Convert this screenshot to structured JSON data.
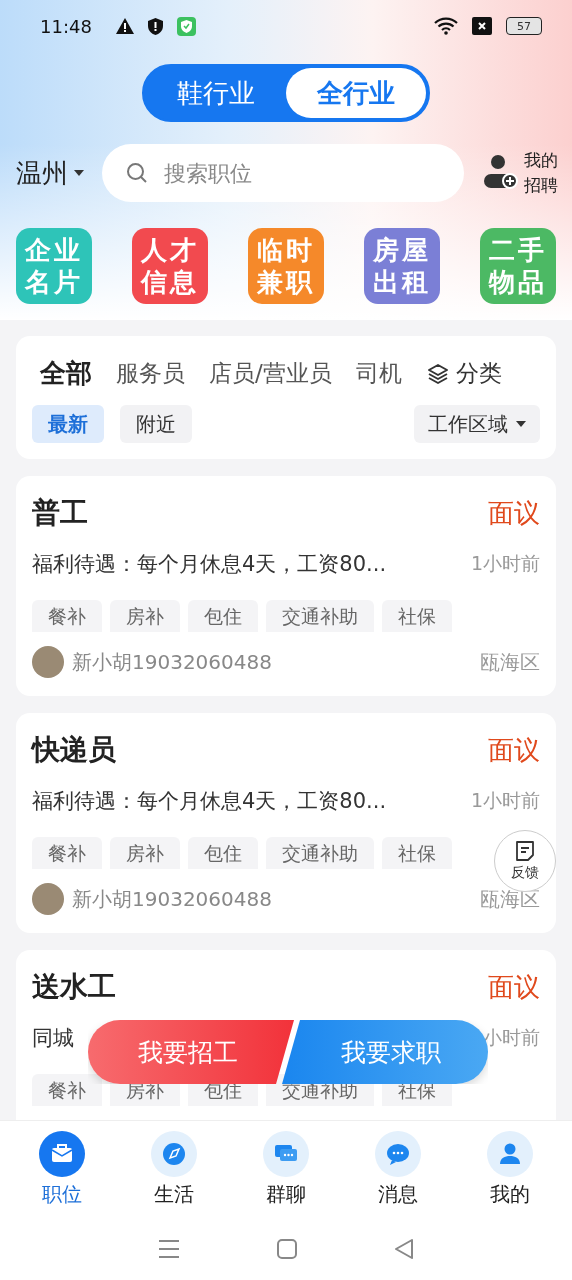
{
  "status_bar": {
    "time": "11:48",
    "battery": "57"
  },
  "industry_toggle": [
    {
      "label": "鞋行业",
      "selected": false
    },
    {
      "label": "全行业",
      "selected": true
    }
  ],
  "city": "温州",
  "search": {
    "placeholder": "搜索职位"
  },
  "my_recruit": [
    "我的",
    "招聘"
  ],
  "shortcuts": [
    {
      "lines": [
        "企业",
        "名片"
      ],
      "color": "#2ec4b8"
    },
    {
      "lines": [
        "人才",
        "信息"
      ],
      "color": "#f24a4f"
    },
    {
      "lines": [
        "临时",
        "兼职"
      ],
      "color": "#f5892a"
    },
    {
      "lines": [
        "房屋",
        "出租"
      ],
      "color": "#7b7fd6"
    },
    {
      "lines": [
        "二手",
        "物品"
      ],
      "color": "#4cb964"
    }
  ],
  "categories": [
    {
      "label": "全部",
      "selected": true
    },
    {
      "label": "服务员",
      "selected": false
    },
    {
      "label": "店员/营业员",
      "selected": false
    },
    {
      "label": "司机",
      "selected": false
    }
  ],
  "classify_button": "分类",
  "sort_chips": [
    {
      "label": "最新",
      "selected": true
    },
    {
      "label": "附近",
      "selected": false
    }
  ],
  "area_filter": "工作区域",
  "jobs": [
    {
      "title": "普工",
      "salary": "面议",
      "description": "福利待遇：每个月休息4天，工资80...",
      "posted": "1小时前",
      "tags": [
        "餐补",
        "房补",
        "包住",
        "交通补助",
        "社保"
      ],
      "poster": "新小胡19032060488",
      "location": "瓯海区"
    },
    {
      "title": "快递员",
      "salary": "面议",
      "description": "福利待遇：每个月休息4天，工资80...",
      "posted": "1小时前",
      "tags": [
        "餐补",
        "房补",
        "包住",
        "交通补助",
        "社保"
      ],
      "poster": "新小胡19032060488",
      "location": "瓯海区"
    },
    {
      "title": "送水工",
      "salary": "面议",
      "description": "同城",
      "posted": "小时前",
      "tags": [
        "餐补",
        "房补",
        "包住",
        "交通补助",
        "社保"
      ]
    }
  ],
  "floating_actions": [
    {
      "label": "我要招工",
      "kind": "recruit"
    },
    {
      "label": "我要求职",
      "kind": "seek"
    }
  ],
  "feedback": "反馈",
  "bottom_nav": [
    {
      "label": "职位",
      "selected": true
    },
    {
      "label": "生活",
      "selected": false
    },
    {
      "label": "群聊",
      "selected": false
    },
    {
      "label": "消息",
      "selected": false
    },
    {
      "label": "我的",
      "selected": false
    }
  ]
}
